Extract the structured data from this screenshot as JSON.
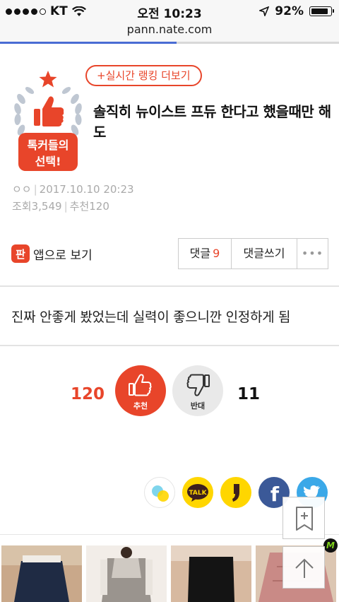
{
  "status_bar": {
    "carrier": "KT",
    "time": "오전 10:23",
    "battery": "92%",
    "battery_level": 0.92
  },
  "browser": {
    "url": "pann.nate.com",
    "load_progress": 0.52
  },
  "post": {
    "ranking_link": "+실시간 랭킹 더보기",
    "badge_text_line1": "톡커들의",
    "badge_text_line2": "선택!",
    "title": "솔직히 뉴이스트 프듀 한다고 했을때만 해도",
    "author": "ㅇㅇ",
    "date": "2017.10.10 20:23",
    "views_label": "조회",
    "views": "3,549",
    "recommend_label": "추천",
    "recommend": "120",
    "body": "진짜 안좋게 봤었는데 실력이 좋으니깐 인정하게 됨"
  },
  "actions": {
    "app_view_icon": "판",
    "app_view_label": "앱으로 보기",
    "comments_label": "댓글",
    "comments_count": "9",
    "write_comment_label": "댓글쓰기",
    "more_label": "•••"
  },
  "votes": {
    "up_count": "120",
    "up_label": "추천",
    "down_count": "11",
    "down_label": "반대"
  },
  "share": {
    "icons": [
      "line-icon",
      "kakaotalk-icon",
      "kakaostory-icon",
      "facebook-icon",
      "twitter-icon"
    ],
    "talk_label": "TALK",
    "fb_label": "f"
  },
  "ad_badge": "M",
  "colors": {
    "accent": "#e8452a",
    "facebook": "#3b5998",
    "twitter": "#3aa8e8",
    "kakao": "#ffd600"
  }
}
